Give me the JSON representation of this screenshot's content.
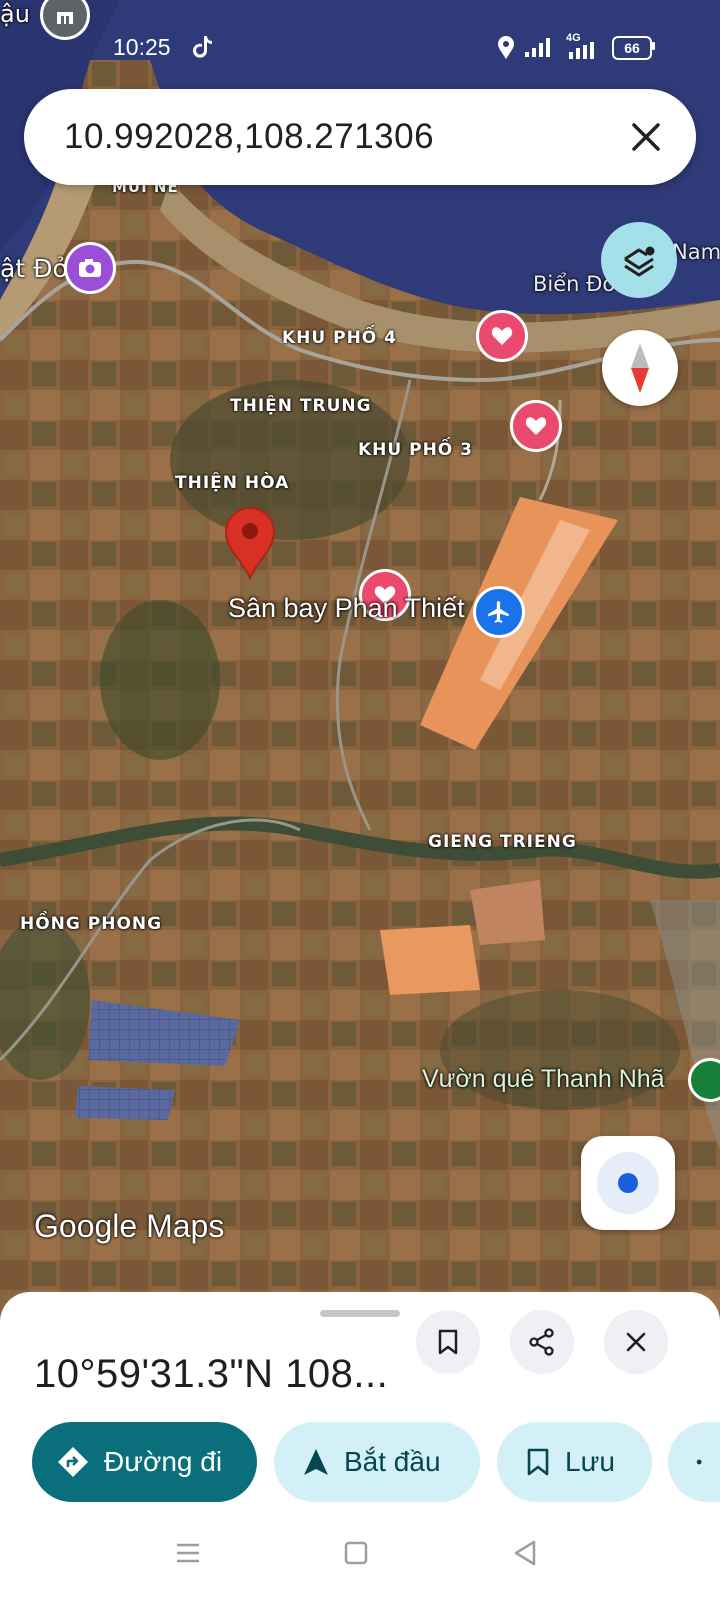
{
  "status": {
    "time": "10:25",
    "network": "4G",
    "battery": "66"
  },
  "search": {
    "query": "10.992028,108.271306"
  },
  "map": {
    "labels": {
      "top_left": "ậu",
      "mui_ne": "MŨI NÉ",
      "dat_do": "ật Đỏ",
      "bien_dong": "Biển Đô",
      "nam": "Nam",
      "khu_pho_4": "KHU PHỐ 4",
      "thien_trung": "THIỆN TRUNG",
      "khu_pho_3": "KHU PHỐ 3",
      "thien_hoa": "THIỆN HÒA",
      "gieng_trieng": "GIENG TRIENG",
      "hong_phong": "HỒNG PHONG"
    },
    "poi": {
      "airport": "Sân bay Phan Thiết",
      "garden": "Vườn quê Thanh Nhã"
    },
    "watermark": "Google Maps"
  },
  "sheet": {
    "coords": "10°59'31.3\"N 108...",
    "actions": {
      "directions": "Đường đi",
      "start": "Bắt đầu",
      "save": "Lưu"
    }
  },
  "colors": {
    "teal": "#0b6e7b",
    "pill": "#d3f0f7",
    "pin": "#d93025",
    "poi_pink": "#e94a6d"
  }
}
